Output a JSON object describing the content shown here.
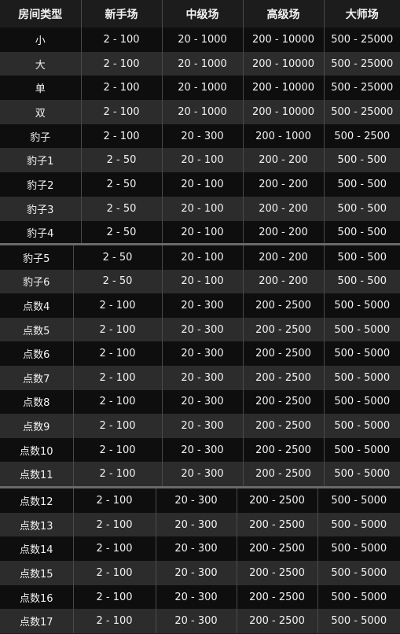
{
  "header": [
    "房间类型",
    "新手场",
    "中级场",
    "高级场",
    "大师场"
  ],
  "rows": [
    [
      "小",
      "2 - 100",
      "20 - 1000",
      "200 - 10000",
      "500 - 25000"
    ],
    [
      "大",
      "2 - 100",
      "20 - 1000",
      "200 - 10000",
      "500 - 25000"
    ],
    [
      "单",
      "2 - 100",
      "20 - 1000",
      "200 - 10000",
      "500 - 25000"
    ],
    [
      "双",
      "2 - 100",
      "20 - 1000",
      "200 - 10000",
      "500 - 25000"
    ],
    [
      "豹子",
      "2 - 100",
      "20 - 300",
      "200 - 1000",
      "500 - 2500"
    ],
    [
      "豹子1",
      "2 - 50",
      "20 - 100",
      "200 - 200",
      "500 - 500"
    ],
    [
      "豹子2",
      "2 - 50",
      "20 - 100",
      "200 - 200",
      "500 - 500"
    ],
    [
      "豹子3",
      "2 - 50",
      "20 - 100",
      "200 - 200",
      "500 - 500"
    ],
    [
      "豹子4",
      "2 - 50",
      "20 - 100",
      "200 - 200",
      "500 - 500"
    ],
    [
      "豹子5",
      "2 - 50",
      "20 - 100",
      "200 - 200",
      "500 - 500"
    ],
    [
      "豹子6",
      "2 - 50",
      "20 - 100",
      "200 - 200",
      "500 - 500"
    ],
    [
      "点数4",
      "2 - 100",
      "20 - 300",
      "200 - 2500",
      "500 - 5000"
    ],
    [
      "点数5",
      "2 - 100",
      "20 - 300",
      "200 - 2500",
      "500 - 5000"
    ],
    [
      "点数6",
      "2 - 100",
      "20 - 300",
      "200 - 2500",
      "500 - 5000"
    ],
    [
      "点数7",
      "2 - 100",
      "20 - 300",
      "200 - 2500",
      "500 - 5000"
    ],
    [
      "点数8",
      "2 - 100",
      "20 - 300",
      "200 - 2500",
      "500 - 5000"
    ],
    [
      "点数9",
      "2 - 100",
      "20 - 300",
      "200 - 2500",
      "500 - 5000"
    ],
    [
      "点数10",
      "2 - 100",
      "20 - 300",
      "200 - 2500",
      "500 - 5000"
    ],
    [
      "点数11",
      "2 - 100",
      "20 - 300",
      "200 - 2500",
      "500 - 5000"
    ],
    [
      "点数12",
      "2 - 100",
      "20 - 300",
      "200 - 2500",
      "500 - 5000"
    ],
    [
      "点数13",
      "2 - 100",
      "20 - 300",
      "200 - 2500",
      "500 - 5000"
    ],
    [
      "点数14",
      "2 - 100",
      "20 - 300",
      "200 - 2500",
      "500 - 5000"
    ],
    [
      "点数15",
      "2 - 100",
      "20 - 300",
      "200 - 2500",
      "500 - 5000"
    ],
    [
      "点数16",
      "2 - 100",
      "20 - 300",
      "200 - 2500",
      "500 - 5000"
    ],
    [
      "点数17",
      "2 - 100",
      "20 - 300",
      "200 - 2500",
      "500 - 5000"
    ]
  ]
}
